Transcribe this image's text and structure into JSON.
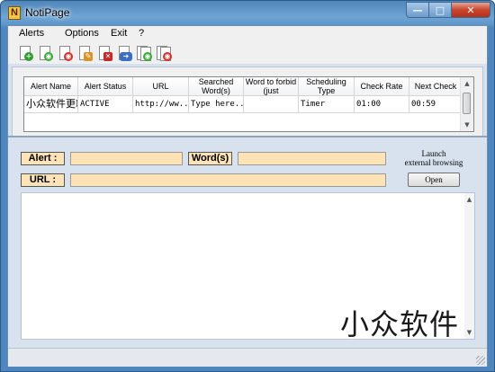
{
  "window": {
    "title": "NotiPage",
    "app_icon_letter": "N",
    "min_glyph": "—",
    "max_glyph": "□",
    "close_glyph": "✕"
  },
  "menu": {
    "items": [
      "Alerts",
      "Options",
      "Exit",
      "?"
    ]
  },
  "toolbar": {
    "icons": [
      "add-alert-icon",
      "start-alert-icon",
      "stop-alert-icon",
      "edit-alert-icon",
      "delete-alert-icon",
      "check-now-icon",
      "start-all-icon",
      "stop-all-icon"
    ]
  },
  "grid": {
    "columns": [
      "Alert Name",
      "Alert Status",
      "URL",
      "Searched Word(s)",
      "Word to forbid (just",
      "Scheduling Type",
      "Check Rate",
      "Next Check"
    ],
    "rows": [
      [
        "小众软件更新",
        "ACTIVE",
        "http://ww...",
        "Type here...",
        "",
        "Timer",
        "01:00",
        "00:59"
      ]
    ],
    "scroll": {
      "up": "▲",
      "down": "▼"
    }
  },
  "detail": {
    "alert_label": "Alert :",
    "alert_value": "",
    "words_label": "Word(s)",
    "words_value": "",
    "url_label": "URL :",
    "url_value": "",
    "launch_line1": "Launch",
    "launch_line2": "external browsing",
    "open_button": "Open"
  },
  "browser": {
    "scroll": {
      "up": "▲",
      "down": "▼"
    }
  },
  "watermark": "小众软件",
  "colors": {
    "field_bg": "#fde3b5",
    "client_bg": "#d7e2ee",
    "titlebar": "#5f97cb",
    "close_btn": "#c8452d"
  }
}
